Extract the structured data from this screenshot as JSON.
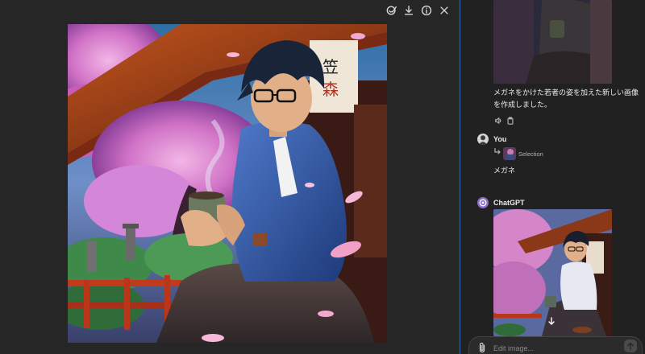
{
  "viewer": {
    "toolbar": [
      {
        "name": "edit-selection",
        "icon": "brush-icon"
      },
      {
        "name": "download",
        "icon": "download-icon"
      },
      {
        "name": "info",
        "icon": "info-icon"
      },
      {
        "name": "close",
        "icon": "close-icon"
      }
    ],
    "image": {
      "content": "anime young man with glasses holding steaming tea cup under cherry blossoms at a temple"
    }
  },
  "chat": {
    "message1": {
      "text": "メガネをかけた若者の姿を加えた新しい画像を作成しました。",
      "actions": [
        "speaker-icon",
        "clipboard-icon"
      ]
    },
    "message2": {
      "sender": "You",
      "selection_label": "Selection",
      "text": "メガネ"
    },
    "message3": {
      "sender": "ChatGPT"
    },
    "composer": {
      "placeholder": "Edit image..."
    }
  },
  "colors": {
    "background": "#212121",
    "viewer_background": "#262626",
    "divider": "#3c6fb0",
    "chatgpt_avatar": "#8b6cc8"
  }
}
